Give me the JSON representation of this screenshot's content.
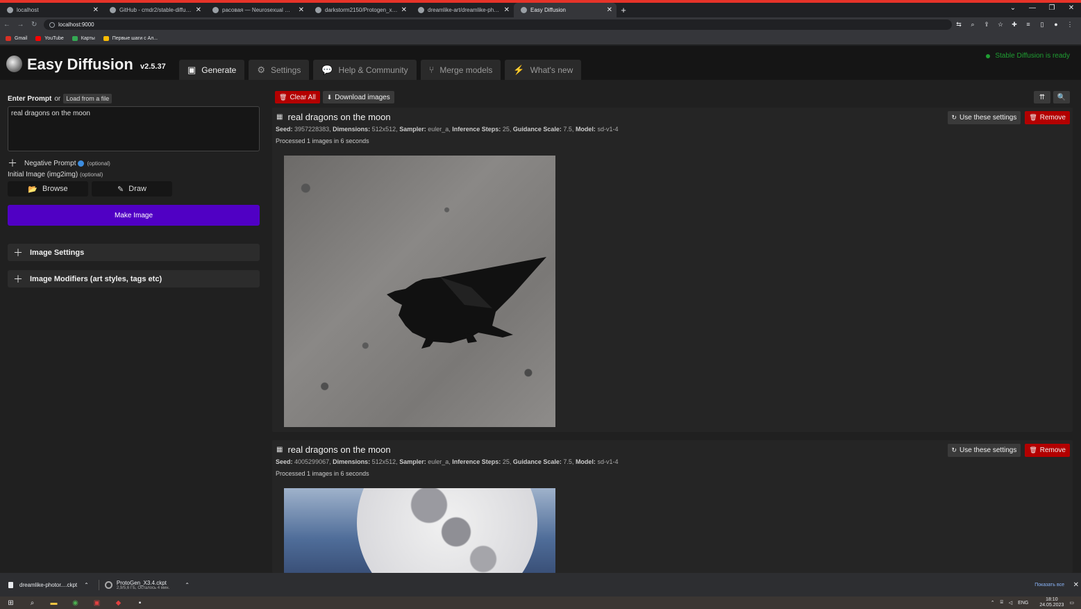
{
  "browser": {
    "tabs": [
      {
        "title": "localhost",
        "active": false
      },
      {
        "title": "GitHub - cmdr2/stable-diffusion",
        "active": false
      },
      {
        "title": "расовая — Neurosexual — Dra",
        "active": false
      },
      {
        "title": "darkstorm2150/Protogen_x3.4_O",
        "active": false
      },
      {
        "title": "dreamlike-art/dreamlike-photor",
        "active": false
      },
      {
        "title": "Easy Diffusion",
        "active": true
      }
    ],
    "url": "localhost:9000",
    "bookmarks": [
      {
        "label": "Gmail",
        "color": "#d93025"
      },
      {
        "label": "YouTube",
        "color": "#ff0000"
      },
      {
        "label": "Карты",
        "color": "#34a853"
      },
      {
        "label": "Первые шаги с Ал...",
        "color": "#fbbc04"
      }
    ]
  },
  "app": {
    "title": "Easy Diffusion",
    "version": "v2.5.37",
    "status": "Stable Diffusion is ready",
    "nav": [
      {
        "label": "Generate",
        "icon": "image-icon",
        "glyph": "▣",
        "active": true
      },
      {
        "label": "Settings",
        "icon": "gear-icon",
        "glyph": "⚙",
        "active": false
      },
      {
        "label": "Help & Community",
        "icon": "comments-icon",
        "glyph": "💬",
        "active": false
      },
      {
        "label": "Merge models",
        "icon": "code-branch-icon",
        "glyph": "⑂",
        "active": false
      },
      {
        "label": "What's new",
        "icon": "bolt-icon",
        "glyph": "⚡",
        "active": false
      }
    ]
  },
  "left": {
    "prompt_label": "Enter Prompt",
    "or_text": "or",
    "load_file": "Load from a file",
    "prompt_value": "real dragons on the moon",
    "negative_label": "Negative Prompt",
    "optional": "(optional)",
    "initial_image_label": "Initial Image (img2img)",
    "browse_label": "Browse",
    "draw_label": "Draw",
    "make_image": "Make Image",
    "image_settings": "Image Settings",
    "image_modifiers": "Image Modifiers (art styles, tags etc)"
  },
  "right": {
    "clear_all": "Clear All",
    "download_images": "Download images",
    "use_settings": "Use these settings",
    "remove": "Remove",
    "results": [
      {
        "title": "real dragons on the moon",
        "seed": "3957228383",
        "dimensions": "512x512",
        "sampler": "euler_a",
        "steps": "25",
        "guidance": "7.5",
        "model": "sd-v1-4",
        "processed": "Processed 1 images in 6 seconds",
        "image": "dragon-on-moon-image"
      },
      {
        "title": "real dragons on the moon",
        "seed": "4005299067",
        "dimensions": "512x512",
        "sampler": "euler_a",
        "steps": "25",
        "guidance": "7.5",
        "model": "sd-v1-4",
        "processed": "Processed 1 images in 6 seconds",
        "image": "moon-sky-image"
      }
    ],
    "meta_labels": {
      "seed": "Seed:",
      "dimensions": "Dimensions:",
      "sampler": "Sampler:",
      "steps": "Inference Steps:",
      "guidance": "Guidance Scale:",
      "model": "Model:"
    }
  },
  "downloads": {
    "item1": "dreamlike-photor....ckpt",
    "item2_name": "ProtoGen_X3.4.ckpt",
    "item2_sub": "2,9/5,6 ГБ, Осталось 4 мин.",
    "show_all": "Показать все"
  },
  "taskbar": {
    "lang": "ENG",
    "time": "18:10",
    "date": "24.05.2023"
  },
  "colors": {
    "accent_purple": "#5000c4",
    "danger_red": "#b30000",
    "status_green": "#1f9e32"
  }
}
